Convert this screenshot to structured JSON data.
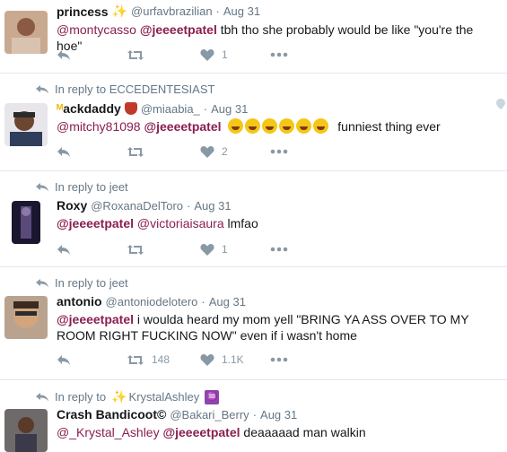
{
  "tweets": [
    {
      "reply_to": null,
      "name": "princess",
      "handle": "@urfavbrazilian",
      "dot": "·",
      "time": "Aug 31",
      "body_parts": [
        "@montycasso",
        "@jeeeetpatel",
        "tbh tho she probably would be like \"you're the hoe\""
      ],
      "retweets": "",
      "likes": "1"
    },
    {
      "reply_to": "In reply to ECCEDENTESIAST",
      "name": "ackdaddy",
      "handle": "@miaabia_",
      "dot": "·",
      "time": "Aug 31",
      "body_parts": [
        "@mitchy81098",
        "@jeeeetpatel",
        "funniest thing ever"
      ],
      "retweets": "",
      "likes": "2"
    },
    {
      "reply_to": "In reply to jeet",
      "name": "Roxy",
      "handle": "@RoxanaDelToro",
      "dot": "·",
      "time": "Aug 31",
      "body_parts": [
        "@jeeeetpatel",
        "@victoriaisaura",
        "lmfao"
      ],
      "retweets": "",
      "likes": "1"
    },
    {
      "reply_to": "In reply to jeet",
      "name": "antonio",
      "handle": "@antoniodelotero",
      "dot": "·",
      "time": "Aug 31",
      "body_parts": [
        "@jeeeetpatel",
        "i woulda heard my mom yell \"BRING YA ASS OVER TO MY ROOM RIGHT FUCKING NOW\" even if i wasn't home"
      ],
      "retweets": "148",
      "likes": "1.1K"
    },
    {
      "reply_to_prefix": "In reply to",
      "reply_to_name": "KrystalAshley",
      "name": "Crash Bandicoot©",
      "handle": "@Bakari_Berry",
      "dot": "·",
      "time": "Aug 31",
      "body_parts": [
        "@_Krystal_Ashley",
        "@jeeeetpatel",
        "deaaaaad man walkin"
      ]
    }
  ],
  "colors": {
    "mention": "#8b1e50",
    "muted": "#657786",
    "icon": "#8899a6"
  }
}
